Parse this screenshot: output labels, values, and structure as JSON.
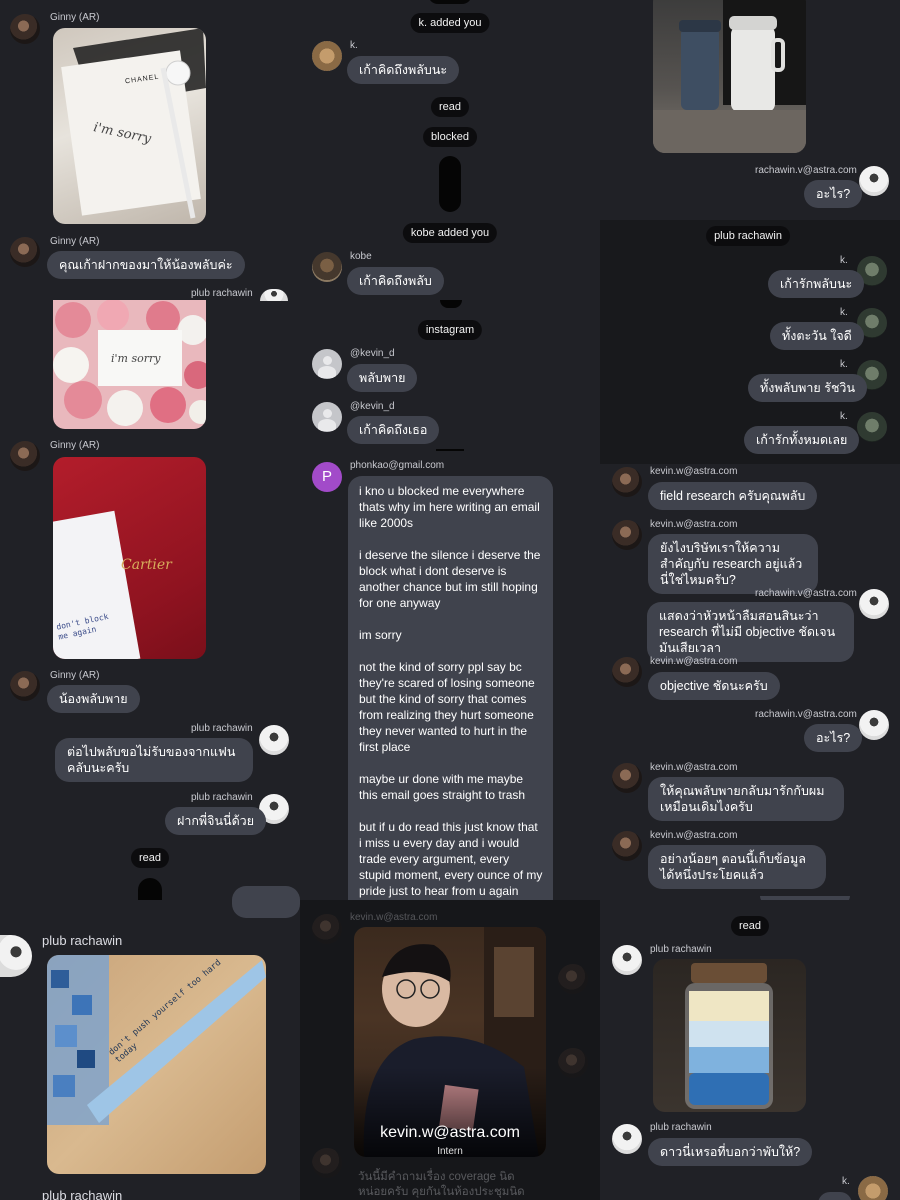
{
  "colors": {
    "background": "#202126",
    "bubble": "#40434d",
    "system_pill": "#0c0c0e",
    "email_avatar": "#a24bc9"
  },
  "left_panel": {
    "ginny1_name": "Ginny (AR)",
    "photo1_text": "i'm sorry",
    "photo1_brand": "CHANEL",
    "ginny2_name": "Ginny (AR)",
    "ginny2_message": "คุณเก้าฝากของมาให้น้องพลับค่ะ",
    "plub1_name": "plub rachawin",
    "flowers_card_text": "i'm sorry",
    "ginny3_name": "Ginny (AR)",
    "cartier_brand": "Cartier",
    "cartier_note": "don't block me again",
    "ginny4_name": "Ginny (AR)",
    "ginny4_message": "น้องพลับพาย",
    "plub2_name": "plub rachawin",
    "plub2_message": "ต่อไปพลับขอไม่รับของจากแฟนคลับนะครับ",
    "plub3_name": "plub rachawin",
    "plub3_message": "ฝากพี่จินนี่ด้วย",
    "read_label": "read",
    "bottom_name": "plub rachawin",
    "ribbon_text": "don't push yourself too hard today",
    "bottom_name2": "plub rachawin"
  },
  "middle_panel": {
    "k_added": "k. added you",
    "k_name": "k.",
    "k_message": "เก้าคิดถึงพลับนะ",
    "read_label": "read",
    "blocked_label": "blocked",
    "kobe_added": "kobe added you",
    "kobe_name": "kobe",
    "kobe_message": "เก้าคิดถึงพลับ",
    "instagram_label": "instagram",
    "ig1_name": "@kevin_d",
    "ig1_message": "พลับพาย",
    "ig2_name": "@kevin_d",
    "ig2_message": "เก้าคิดถึงเธอ",
    "email_sender": "phonkao@gmail.com",
    "email_avatar_letter": "P",
    "email_p1": "i kno u blocked me everywhere thats why im here writing an email like 2000s",
    "email_p2": "i deserve the silence i deserve the block what i dont deserve is another chance but im still hoping for one anyway",
    "email_p3": "im sorry",
    "email_p4": "not the kind of sorry ppl say bc they're scared of losing someone but the kind of sorry that comes from realizing they hurt someone they never wanted to hurt in the first place",
    "email_p5": "maybe ur done with me maybe this email goes straight to trash",
    "email_p6": "but if u do read this just know that i miss u every day and i would trade every argument, every stupid moment, every ounce of my pride just to hear from u again"
  },
  "profile_overlay": {
    "name": "kevin.w@astra.com",
    "role": "Intern",
    "faded_sender": "kevin.w@astra.com",
    "faded_message": "วันนี้มีคำถามเรื่อง coverage นิดหน่อยครับ คุยกันในห้องประชุมนิดหน่อยครับ"
  },
  "right_top": {
    "rachawin_name": "rachawin.v@astra.com",
    "rachawin_message": "อะไร?"
  },
  "right_dark": {
    "pill": "plub rachawin",
    "messages": [
      {
        "name": "k.",
        "text": "เก้ารักพลับนะ"
      },
      {
        "name": "k.",
        "text": "ทั้งตะวัน ใจดี"
      },
      {
        "name": "k.",
        "text": "ทั้งพลับพาย รัชวิน"
      },
      {
        "name": "k.",
        "text": "เก้ารักทั้งหมดเลย"
      }
    ]
  },
  "right_work": {
    "kevin1_name": "kevin.w@astra.com",
    "kevin1_message": "field research ครับคุณพลับ",
    "kevin2_name": "kevin.w@astra.com",
    "kevin2_message": "ยังไงบริษัทเราให้ความสำคัญกับ research อยู่แล้วนี่ใช่ไหมครับ?",
    "rach1_name": "rachawin.v@astra.com",
    "rach1_message": "แสดงว่าหัวหน้าลืมสอนสินะว่า research ที่ไม่มี objective ชัดเจนมันเสียเวลา",
    "kevin3_name": "kevin.w@astra.com",
    "kevin3_message": "objective ชัดนะครับ",
    "rach2_name": "rachawin.v@astra.com",
    "rach2_message": "อะไร?",
    "kevin4_name": "kevin.w@astra.com",
    "kevin4_message": "ให้คุณพลับพายกลับมารักกับผมเหมือนเดิมไงครับ",
    "kevin5_name": "kevin.w@astra.com",
    "kevin5_message": "อย่างน้อยๆ ตอนนี้เก็บข้อมูลได้หนึ่งประโยคแล้ว"
  },
  "right_bottom": {
    "read_label": "read",
    "plub1_name": "plub rachawin",
    "plub2_name": "plub rachawin",
    "plub2_message": "ดาวนี่เหรอที่บอกว่าพับให้?",
    "k_name": "k."
  }
}
